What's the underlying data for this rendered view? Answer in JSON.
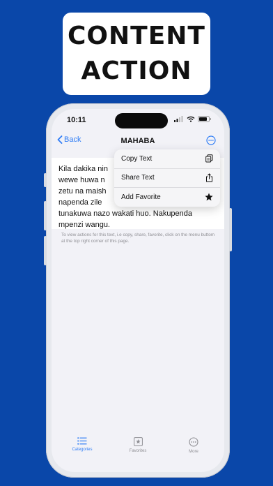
{
  "promo": {
    "line1": "CONTENT",
    "line2": "ACTION"
  },
  "status_bar": {
    "time": "10:11"
  },
  "nav": {
    "back_label": "Back",
    "title": "MAHABA"
  },
  "content": {
    "text": "Kila dakika nina... wewe huwa n... zetu na maish... napenda zile... tunakuwa nazo wakati huo. Nakupenda mpenzi wangu.",
    "line1": "Kila dakika nin",
    "line2": "wewe huwa n",
    "line3": "zetu na maish",
    "line4": "napenda zile",
    "line5": "tunakuwa nazo wakati huo. Nakupenda",
    "line6": "mpenzi wangu."
  },
  "hint": "To view actions for this text, i.e copy, share, favorite, click on the menu buttom at the top right corner of this page.",
  "menu": {
    "items": [
      {
        "label": "Copy Text",
        "icon": "copy-icon"
      },
      {
        "label": "Share Text",
        "icon": "share-icon"
      },
      {
        "label": "Add Favorite",
        "icon": "star-icon"
      }
    ]
  },
  "tabs": [
    {
      "label": "Categories",
      "icon": "list-icon",
      "active": true
    },
    {
      "label": "Favorites",
      "icon": "star-square-icon",
      "active": false
    },
    {
      "label": "More",
      "icon": "ellipsis-circle-icon",
      "active": false
    }
  ],
  "colors": {
    "background": "#0a47a9",
    "accent": "#2e7cf6",
    "inactive": "#8e8e93"
  }
}
